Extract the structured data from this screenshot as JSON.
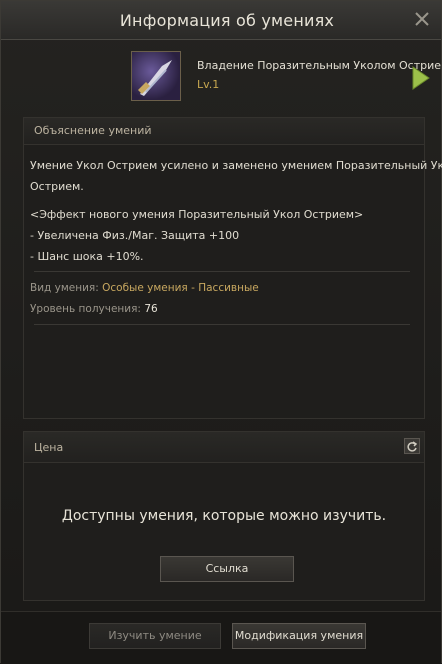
{
  "window": {
    "title": "Информация об умениях"
  },
  "skill": {
    "name": "Владение Поразительным Уколом Острием",
    "level": "Lv.1",
    "icon": "sword-thrust-skill-icon"
  },
  "description": {
    "header": "Объяснение умений",
    "lines": [
      "Умение Укол Острием усилено и заменено умением Поразительный Укол",
      "Острием.",
      "",
      "<Эффект нового умения Поразительный Укол Острием>",
      "- Увеличена Физ./Маг. Защита +100",
      "- Шанс шока +10%."
    ],
    "type_label": "Вид умения",
    "type_value": "Особые умения - Пассивные",
    "acquire_label": "Уровень получения",
    "acquire_value": "76"
  },
  "price": {
    "header": "Цена",
    "available_text": "Доступны умения, которые можно изучить.",
    "link_button": "Ссылка"
  },
  "footer": {
    "learn_button": "Изучить умение",
    "modify_button": "Модификация умения"
  },
  "colors": {
    "accent_gold": "#c8a850",
    "arrow_green": "#9cc04a"
  }
}
